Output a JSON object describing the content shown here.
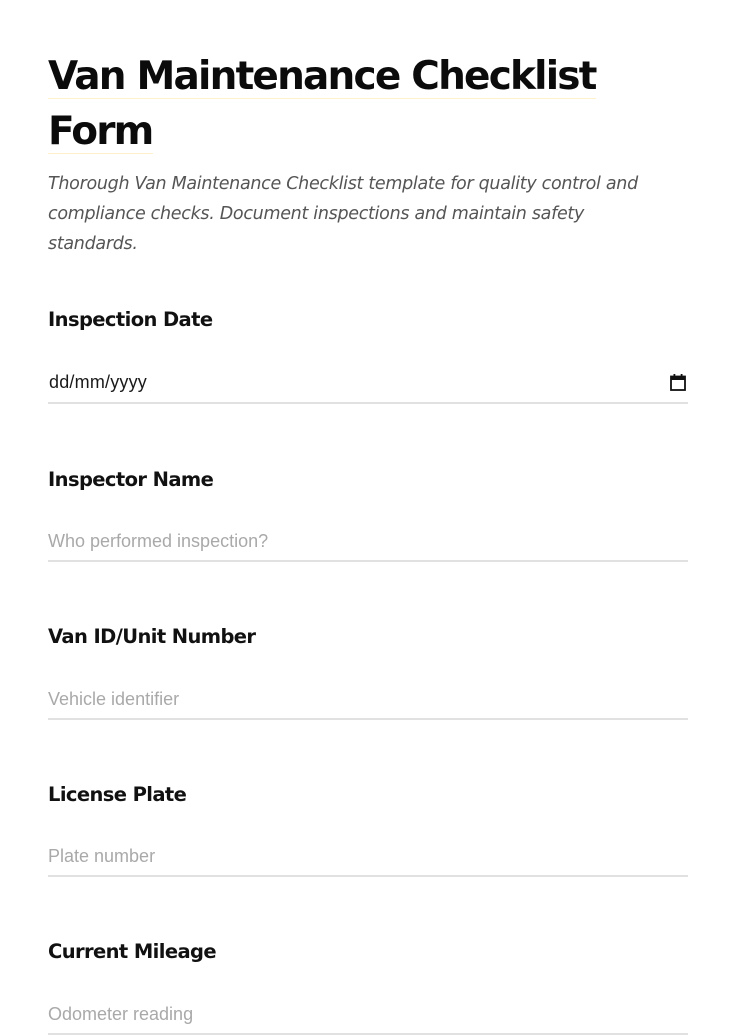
{
  "form": {
    "title_line1": "Van Maintenance Checklist",
    "title_line2": "Form",
    "description": "Thorough Van Maintenance Checklist template for quality control and compliance checks. Document inspections and maintain safety standards."
  },
  "fields": {
    "inspection_date": {
      "label": "Inspection Date",
      "value": "dd/mm/yyyy",
      "icon": "calendar-icon"
    },
    "inspector_name": {
      "label": "Inspector Name",
      "placeholder": "Who performed inspection?"
    },
    "van_id": {
      "label": "Van ID/Unit Number",
      "placeholder": "Vehicle identifier"
    },
    "license_plate": {
      "label": "License Plate",
      "placeholder": "Plate number"
    },
    "current_mileage": {
      "label": "Current Mileage",
      "placeholder": "Odometer reading"
    }
  },
  "colors": {
    "title_highlight": "#fff1cc",
    "input_border": "#e1e1e1",
    "placeholder": "#a9a9a9",
    "description_text": "#555555"
  }
}
